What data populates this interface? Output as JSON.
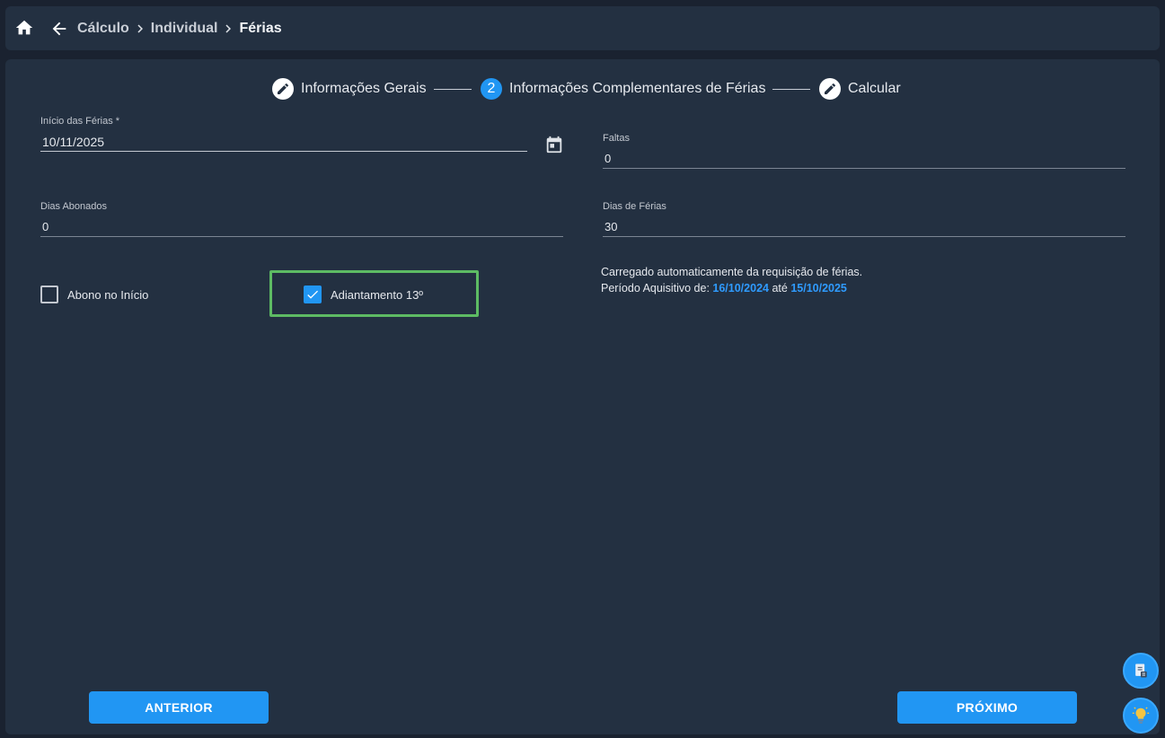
{
  "breadcrumb": {
    "items": [
      "Cálculo",
      "Individual",
      "Férias"
    ]
  },
  "stepper": {
    "steps": [
      {
        "label": "Informações Gerais",
        "icon": "pencil-icon"
      },
      {
        "label": "Informações Complementares de Férias",
        "number": "2"
      },
      {
        "label": "Calcular",
        "icon": "pencil-icon"
      }
    ]
  },
  "form": {
    "inicio_ferias": {
      "label": "Início das Férias *",
      "value": "10/11/2025"
    },
    "faltas": {
      "label": "Faltas",
      "value": "0"
    },
    "dias_abonados": {
      "label": "Dias Abonados",
      "value": "0"
    },
    "dias_ferias": {
      "label": "Dias de Férias",
      "value": "30"
    },
    "abono_inicio": {
      "label": "Abono no Início",
      "checked": false
    },
    "adiantamento": {
      "label": "Adiantamento 13º",
      "checked": true
    }
  },
  "info": {
    "line1": "Carregado automaticamente da requisição de férias.",
    "prefix": "Período Aquisitivo de:",
    "start": "16/10/2024",
    "mid": "até",
    "end": "15/10/2025"
  },
  "actions": {
    "previous": "ANTERIOR",
    "next": "PRÓXIMO"
  },
  "colors": {
    "accent": "#2196f3",
    "highlight": "#5dbb63",
    "panel": "#233041",
    "background": "#1a2230"
  }
}
